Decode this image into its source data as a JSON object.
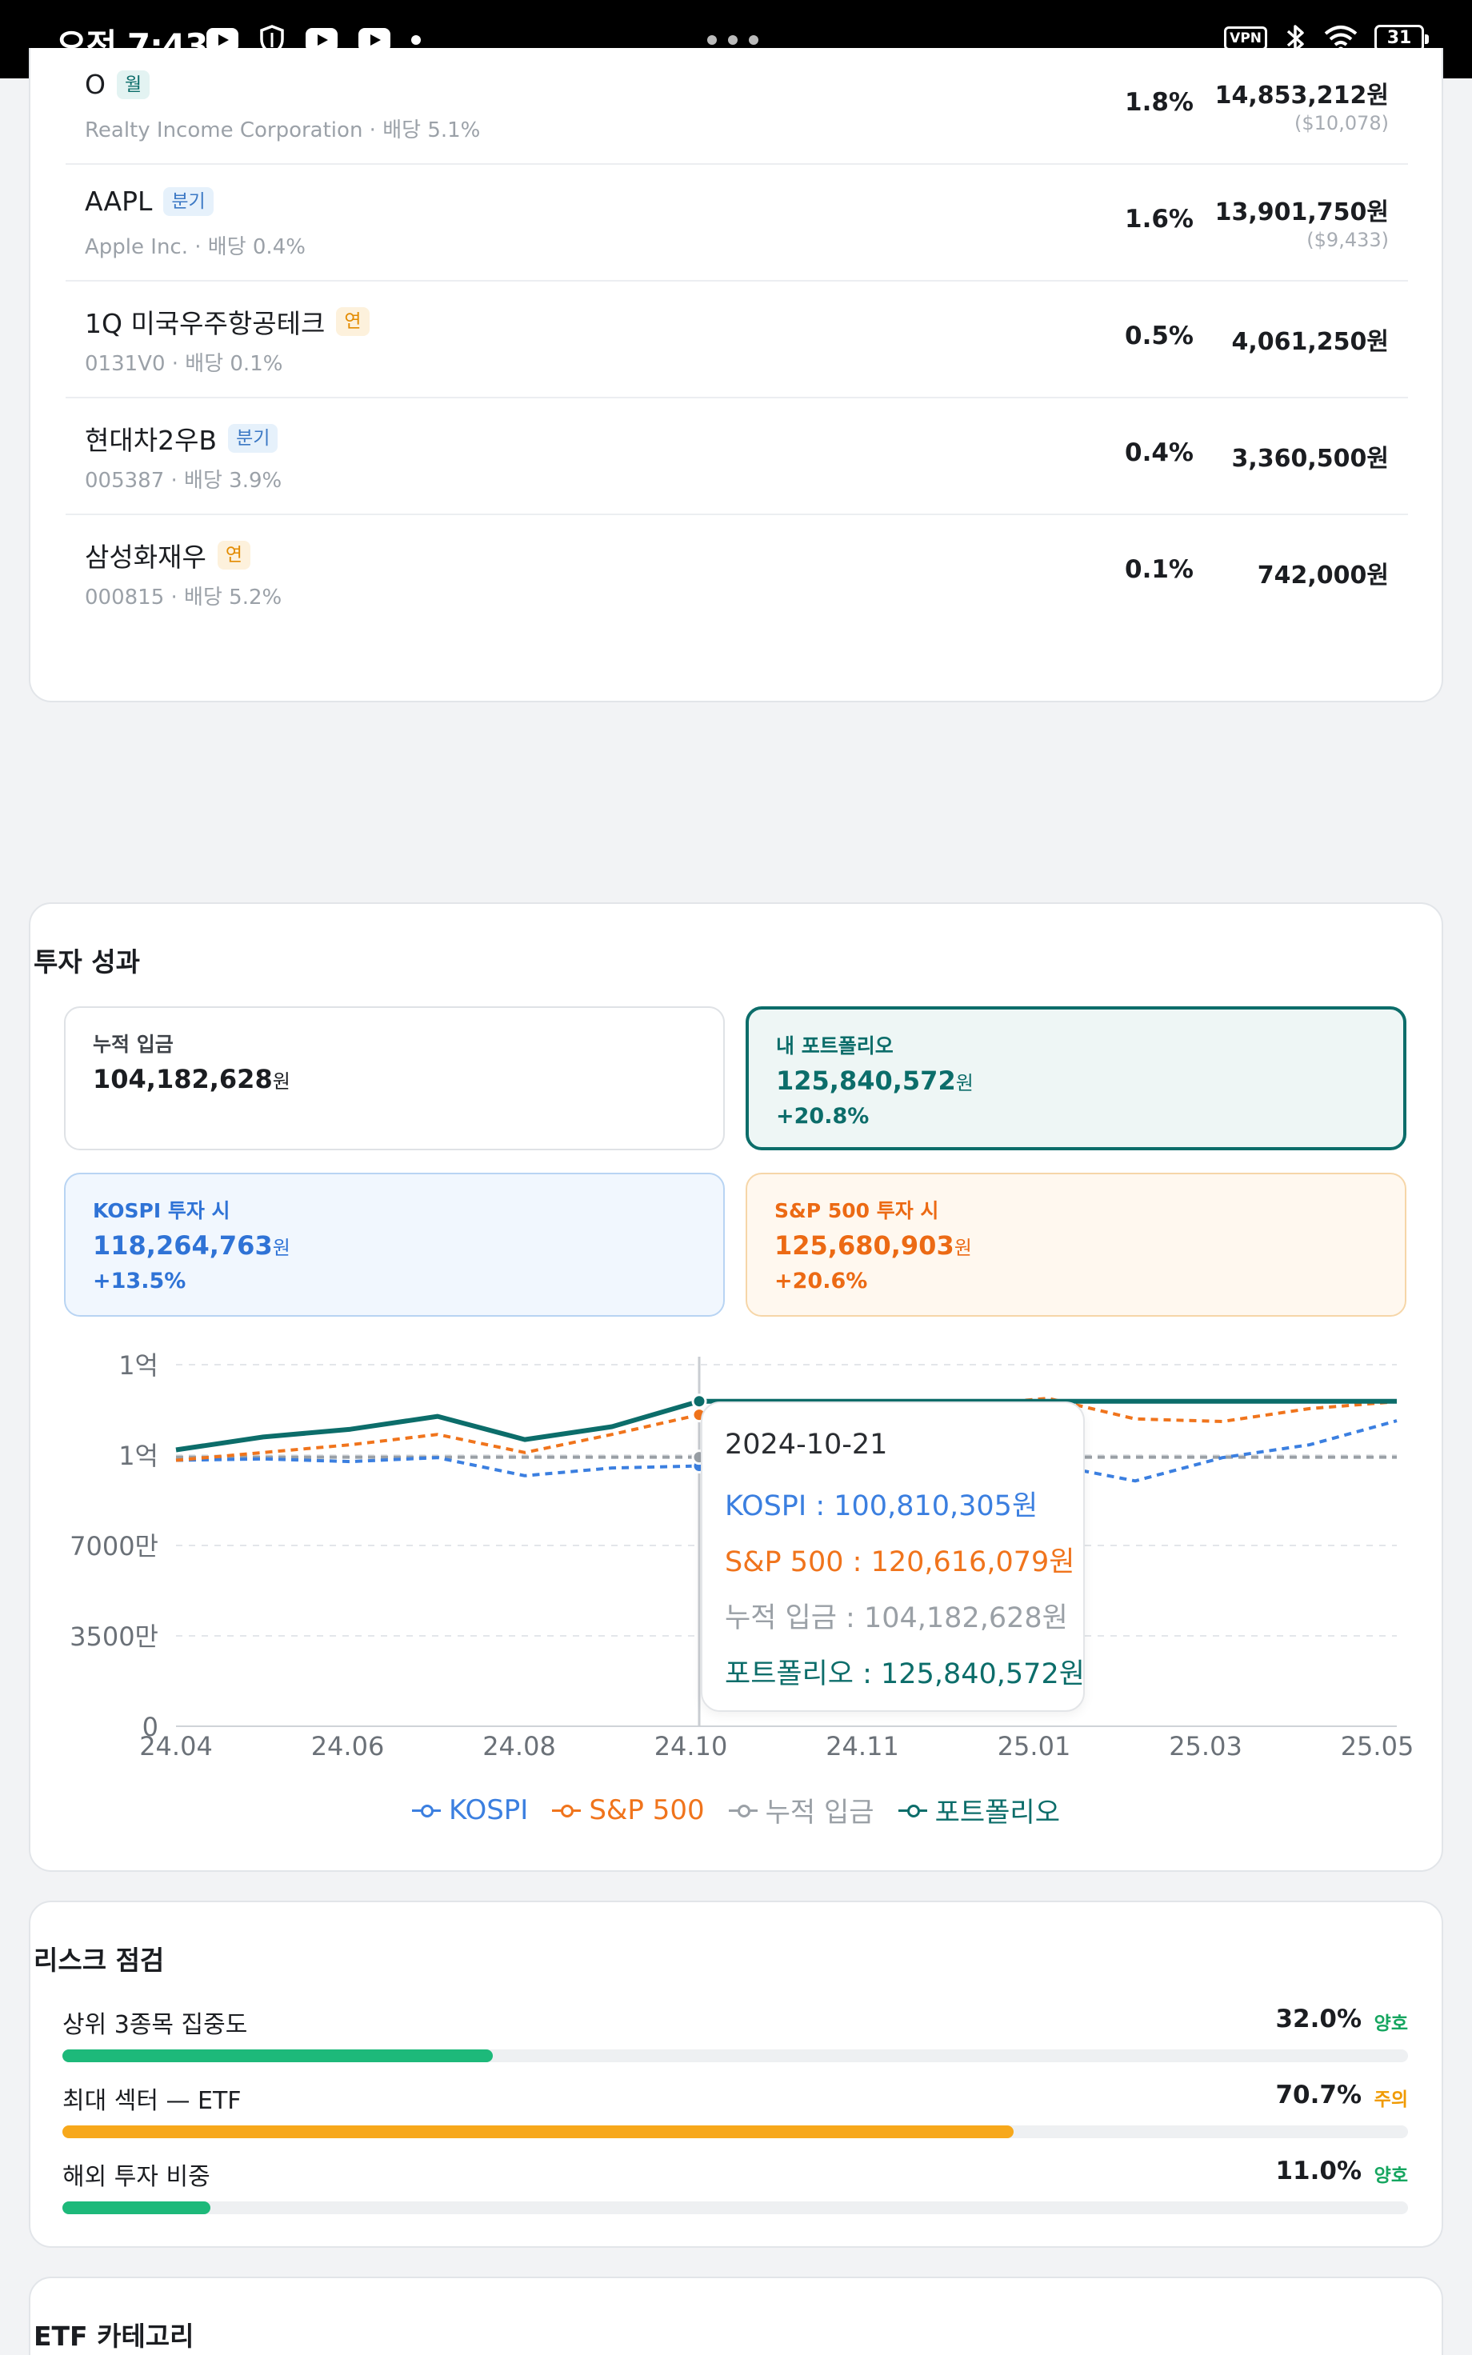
{
  "status_bar": {
    "time": "오전 7:43",
    "vpn": "VPN",
    "battery": "31"
  },
  "holdings": [
    {
      "ticker": "O",
      "badge": "월",
      "badge_color": "teal",
      "sub": "Realty Income Corporation · 배당 5.1%",
      "pct": "1.8%",
      "amount": "14,853,212원",
      "usd": "($10,078)"
    },
    {
      "ticker": "AAPL",
      "badge": "분기",
      "badge_color": "blue",
      "sub": "Apple Inc. · 배당 0.4%",
      "pct": "1.6%",
      "amount": "13,901,750원",
      "usd": "($9,433)"
    },
    {
      "ticker": "1Q 미국우주항공테크",
      "badge": "연",
      "badge_color": "yellow",
      "sub": "0131V0 · 배당 0.1%",
      "pct": "0.5%",
      "amount": "4,061,250원",
      "usd": ""
    },
    {
      "ticker": "현대차2우B",
      "badge": "분기",
      "badge_color": "blue",
      "sub": "005387 · 배당 3.9%",
      "pct": "0.4%",
      "amount": "3,360,500원",
      "usd": ""
    },
    {
      "ticker": "삼성화재우",
      "badge": "연",
      "badge_color": "yellow",
      "sub": "000815 · 배당 5.2%",
      "pct": "0.1%",
      "amount": "742,000원",
      "usd": ""
    }
  ],
  "performance": {
    "title": "투자 성과",
    "deposit": {
      "label": "누적 입금",
      "value": "104,182,628",
      "unit": "원"
    },
    "portfolio": {
      "label": "내 포트폴리오",
      "value": "125,840,572",
      "unit": "원",
      "change": "+20.8%"
    },
    "kospi": {
      "label": "KOSPI 투자 시",
      "value": "118,264,763",
      "unit": "원",
      "change": "+13.5%"
    },
    "sp500": {
      "label": "S&P 500 투자 시",
      "value": "125,680,903",
      "unit": "원",
      "change": "+20.6%"
    },
    "tooltip": {
      "date": "2024-10-21",
      "kospi": "KOSPI : 100,810,305원",
      "sp500": "S&P 500 : 120,616,079원",
      "deposit": "누적 입금 : 104,182,628원",
      "portfolio": "포트폴리오 : 125,840,572원"
    },
    "legend": [
      "KOSPI",
      "S&P 500",
      "누적 입금",
      "포트폴리오"
    ]
  },
  "chart_data": {
    "type": "line",
    "x": [
      "24.04",
      "24.05",
      "24.06",
      "24.07",
      "24.08",
      "24.09",
      "24.10",
      "24.11",
      "24.12",
      "25.01",
      "25.02",
      "25.03",
      "25.04",
      "25.05",
      "25.06"
    ],
    "x_tick_labels": [
      "24.04",
      "24.06",
      "24.08",
      "24.10",
      "24.11",
      "25.01",
      "25.03",
      "25.05"
    ],
    "y_tick_labels": [
      "0",
      "3500만",
      "7000만",
      "1억",
      "1억"
    ],
    "ylim": [
      0,
      140000000
    ],
    "series": [
      {
        "name": "KOSPI",
        "color": "#3b7fe0",
        "dashed": true,
        "values": [
          103000000,
          103500000,
          102500000,
          104000000,
          97000000,
          100000000,
          100800000,
          100500000,
          101000000,
          102000000,
          101500000,
          95000000,
          104000000,
          109000000,
          118300000
        ]
      },
      {
        "name": "S&P 500",
        "color": "#f0741c",
        "dashed": true,
        "values": [
          103000000,
          106000000,
          109000000,
          113000000,
          106000000,
          113000000,
          120600000,
          122000000,
          126000000,
          124000000,
          127000000,
          119000000,
          118000000,
          123000000,
          125700000
        ]
      },
      {
        "name": "누적 입금",
        "color": "#9aa0a6",
        "dashed": true,
        "values": [
          104182628,
          104182628,
          104182628,
          104182628,
          104182628,
          104182628,
          104182628,
          104182628,
          104182628,
          104182628,
          104182628,
          104182628,
          104182628,
          104182628,
          104182628
        ]
      },
      {
        "name": "포트폴리오",
        "color": "#0c6d6a",
        "dashed": false,
        "values": [
          107000000,
          112000000,
          115000000,
          120000000,
          111000000,
          116000000,
          125840572,
          125840572,
          125840572,
          125840572,
          125840572,
          125840572,
          125840572,
          125840572,
          125840572
        ]
      }
    ]
  },
  "risk": {
    "title": "리스크 점검",
    "items": [
      {
        "label": "상위 3종목 집중도",
        "value": "32.0%",
        "status": "양호",
        "status_color": "#16a660",
        "fill": 0.32,
        "bar_color": "#1db97a"
      },
      {
        "label": "최대 섹터 — ETF",
        "value": "70.7%",
        "status": "주의",
        "status_color": "#f09a00",
        "fill": 0.707,
        "bar_color": "#f7a81b"
      },
      {
        "label": "해외 투자 비중",
        "value": "11.0%",
        "status": "양호",
        "status_color": "#16a660",
        "fill": 0.11,
        "bar_color": "#1db97a"
      }
    ]
  },
  "etf": {
    "title": "ETF 카테고리"
  }
}
